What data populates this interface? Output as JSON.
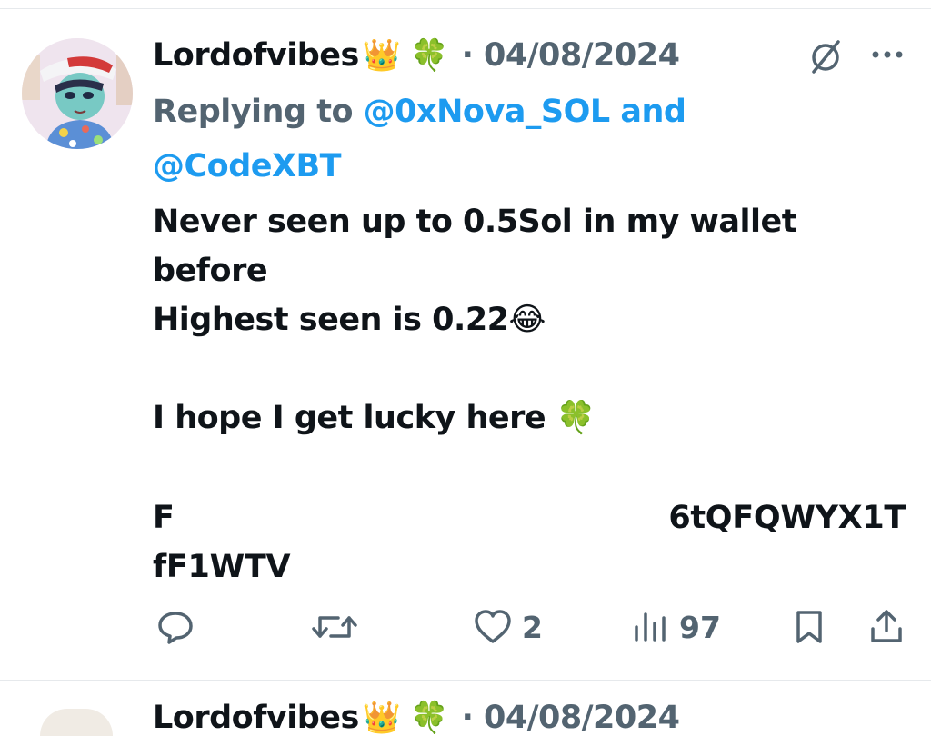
{
  "tweet": {
    "display_name": "Lordofvibes",
    "name_emojis": [
      "👑",
      "🍀"
    ],
    "date": "· 04/08/2024",
    "reply": {
      "prefix": "Replying to ",
      "mention_1": "@0xNova_SOL",
      "conjunction": " and",
      "mention_2": "@CodeXBT"
    },
    "text_lines": [
      "Never seen up to 0.5Sol in my wallet",
      "before",
      "Highest seen is 0.22😂",
      "",
      "I hope I get lucky here 🍀"
    ],
    "wallet_fragments": {
      "line1_start": "F",
      "line1_end": "6tQFQWYX1T",
      "line2_start": "fF1WTV"
    }
  },
  "actions": {
    "reply_count": "",
    "retweet_count": "",
    "like_count": "2",
    "views_count": "97"
  },
  "next_tweet": {
    "display_name": "Lordofvibes",
    "name_emojis": [
      "👑",
      "🍀"
    ],
    "date": "· 04/08/2024"
  },
  "colors": {
    "text": "#0f1419",
    "secondary": "#536471",
    "link": "#1d9bf0",
    "divider": "#e6e9ec"
  },
  "icons": [
    "grok-icon",
    "more-icon",
    "reply-icon",
    "retweet-icon",
    "like-icon",
    "views-icon",
    "bookmark-icon",
    "share-icon"
  ]
}
